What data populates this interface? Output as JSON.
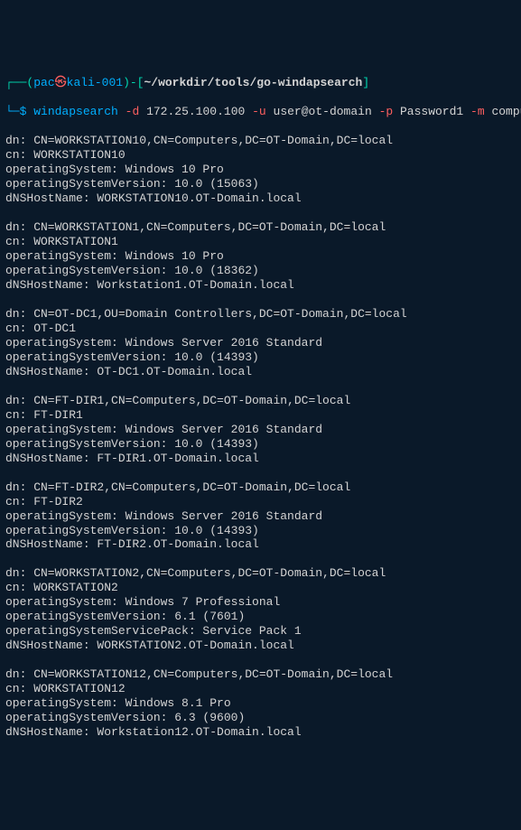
{
  "prompt": {
    "l_box_paren_open": "┌──(",
    "user": "pac",
    "at": "㉿",
    "host": "kali-001",
    "paren_close_dash_bracket": ")-[",
    "path": "~/workdir/tools/go-windapsearch",
    "bracket_close": "]",
    "l_box_dollar": "└─$",
    "space": " "
  },
  "command": {
    "bin": "windapsearch",
    "flag_d": "-d",
    "arg_d": "172.25.100.100",
    "flag_u": "-u",
    "arg_u": "user@ot-domain",
    "flag_p": "-p",
    "arg_p": "Password1",
    "flag_m": "-m",
    "arg_m": "computers"
  },
  "output": {
    "entries": [
      {
        "dn": "dn: CN=WORKSTATION10,CN=Computers,DC=OT-Domain,DC=local",
        "cn": "cn: WORKSTATION10",
        "os": "operatingSystem: Windows 10 Pro",
        "osv": "operatingSystemVersion: 10.0 (15063)",
        "dns": "dNSHostName: WORKSTATION10.OT-Domain.local"
      },
      {
        "dn": "dn: CN=WORKSTATION1,CN=Computers,DC=OT-Domain,DC=local",
        "cn": "cn: WORKSTATION1",
        "os": "operatingSystem: Windows 10 Pro",
        "osv": "operatingSystemVersion: 10.0 (18362)",
        "dns": "dNSHostName: Workstation1.OT-Domain.local"
      },
      {
        "dn": "dn: CN=OT-DC1,OU=Domain Controllers,DC=OT-Domain,DC=local",
        "cn": "cn: OT-DC1",
        "os": "operatingSystem: Windows Server 2016 Standard",
        "osv": "operatingSystemVersion: 10.0 (14393)",
        "dns": "dNSHostName: OT-DC1.OT-Domain.local"
      },
      {
        "dn": "dn: CN=FT-DIR1,CN=Computers,DC=OT-Domain,DC=local",
        "cn": "cn: FT-DIR1",
        "os": "operatingSystem: Windows Server 2016 Standard",
        "osv": "operatingSystemVersion: 10.0 (14393)",
        "dns": "dNSHostName: FT-DIR1.OT-Domain.local"
      },
      {
        "dn": "dn: CN=FT-DIR2,CN=Computers,DC=OT-Domain,DC=local",
        "cn": "cn: FT-DIR2",
        "os": "operatingSystem: Windows Server 2016 Standard",
        "osv": "operatingSystemVersion: 10.0 (14393)",
        "dns": "dNSHostName: FT-DIR2.OT-Domain.local"
      },
      {
        "dn": "dn: CN=WORKSTATION2,CN=Computers,DC=OT-Domain,DC=local",
        "cn": "cn: WORKSTATION2",
        "os": "operatingSystem: Windows 7 Professional",
        "osv": "operatingSystemVersion: 6.1 (7601)",
        "sp": "operatingSystemServicePack: Service Pack 1",
        "dns": "dNSHostName: WORKSTATION2.OT-Domain.local"
      },
      {
        "dn": "dn: CN=WORKSTATION12,CN=Computers,DC=OT-Domain,DC=local",
        "cn": "cn: WORKSTATION12",
        "os": "operatingSystem: Windows 8.1 Pro",
        "osv": "operatingSystemVersion: 6.3 (9600)",
        "dns": "dNSHostName: Workstation12.OT-Domain.local"
      }
    ]
  }
}
